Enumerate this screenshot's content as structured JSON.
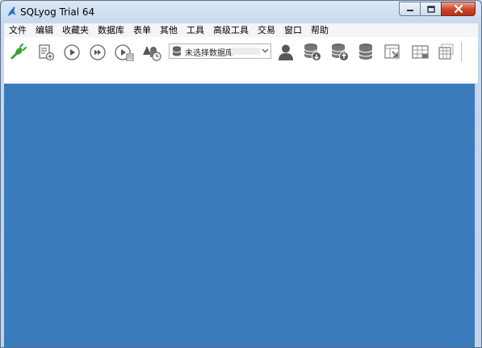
{
  "window": {
    "title": "SQLyog Trial 64"
  },
  "menu": [
    "文件",
    "编辑",
    "收藏夹",
    "数据库",
    "表单",
    "其他",
    "工具",
    "高级工具",
    "交易",
    "窗口",
    "帮助"
  ],
  "toolbar": {
    "database_selector": {
      "value": "未选择数据库"
    },
    "buttons": [
      "connect-icon",
      "new-query-editor-icon",
      "execute-query-icon",
      "execute-all-queries-icon",
      "execute-and-edit-icon",
      "schema-designer-icon",
      "user-manager-icon",
      "backup-database-icon",
      "restore-database-icon",
      "database-sync-icon",
      "import-external-data-icon",
      "table-data-icon",
      "table-structure-icon"
    ]
  },
  "colors": {
    "workspace": "#3a7bbb",
    "connect_green": "#3aa336",
    "close_button": "#c8442a"
  }
}
